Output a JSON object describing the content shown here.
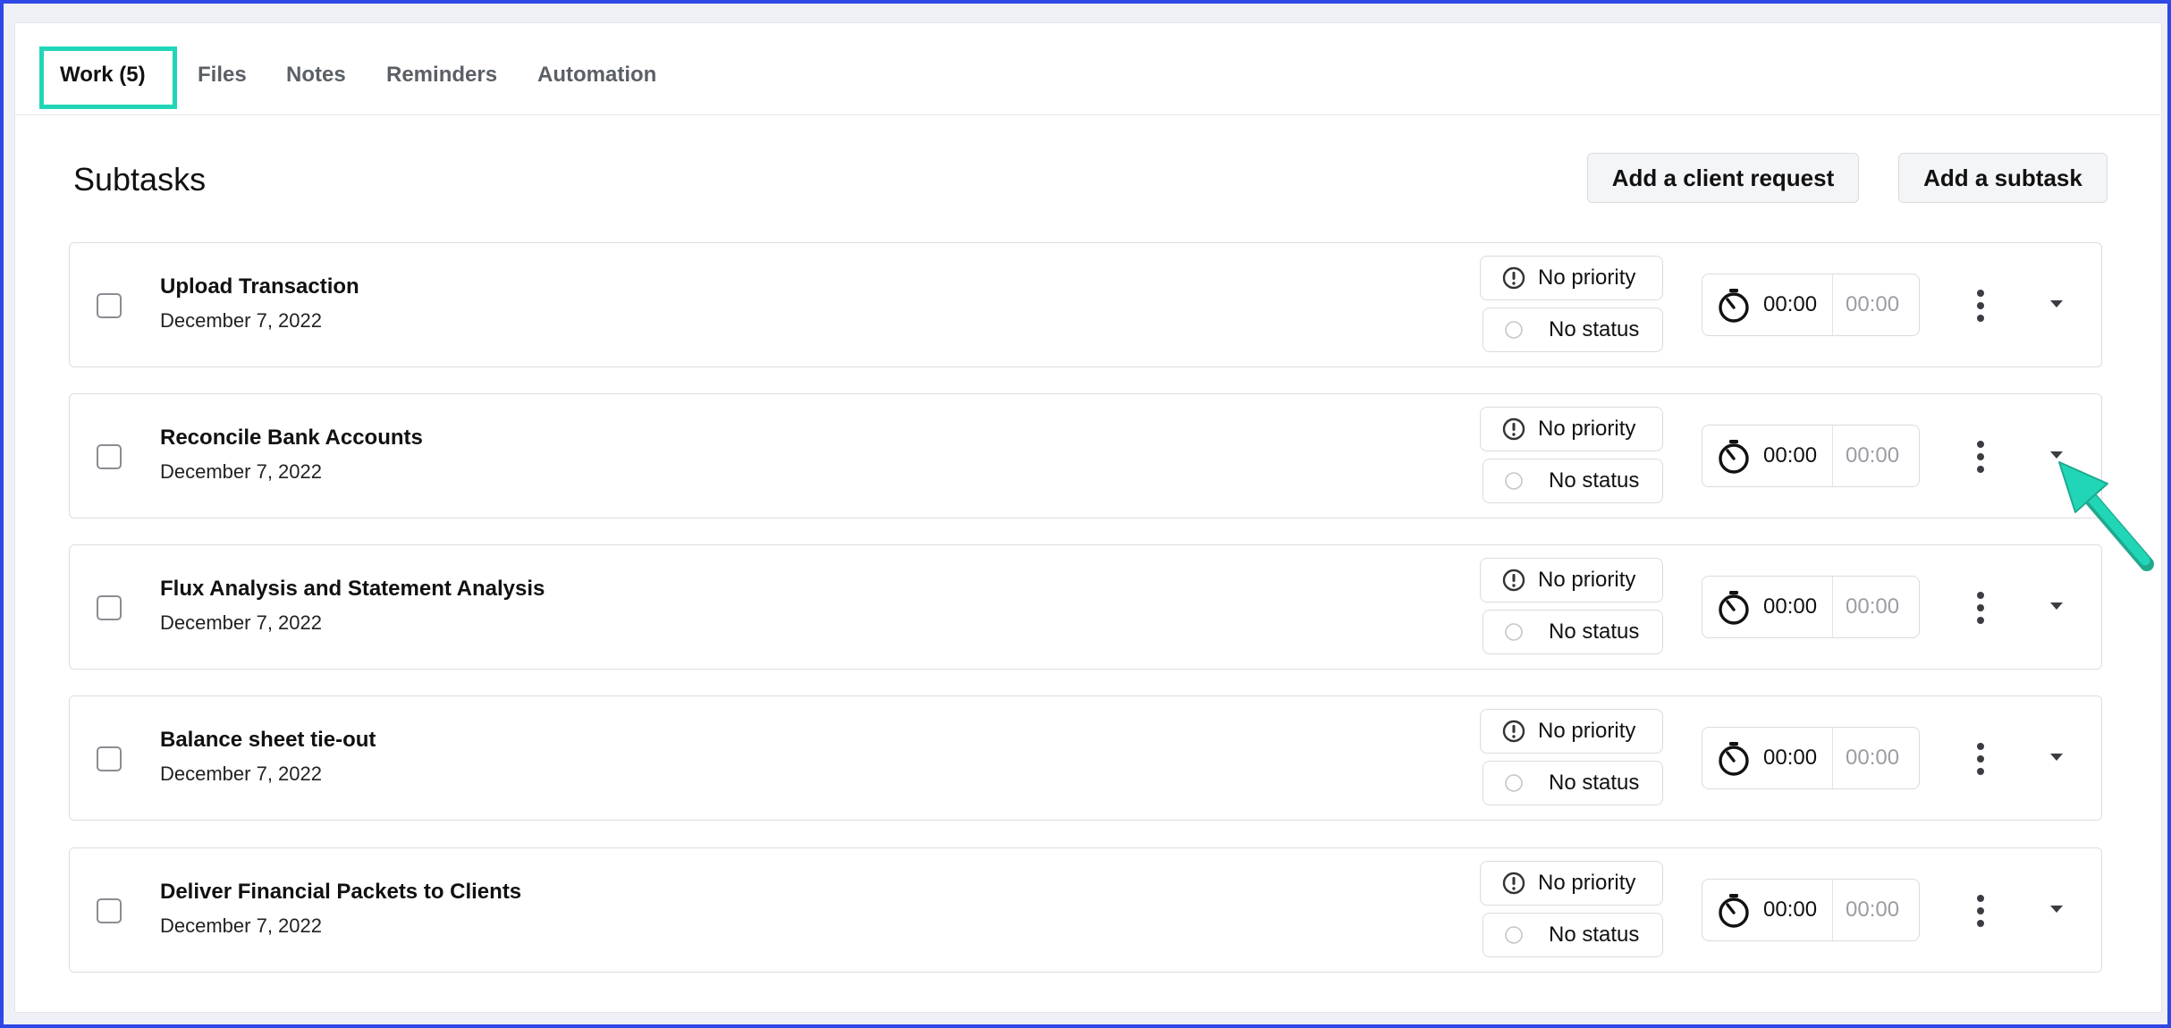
{
  "tabs": [
    {
      "label": "Work  (5)",
      "active": true
    },
    {
      "label": "Files",
      "active": false
    },
    {
      "label": "Notes",
      "active": false
    },
    {
      "label": "Reminders",
      "active": false
    },
    {
      "label": "Automation",
      "active": false
    }
  ],
  "header": {
    "title": "Subtasks",
    "add_client_request_label": "Add a client request",
    "add_subtask_label": "Add a subtask"
  },
  "subtasks": [
    {
      "name": "Upload Transaction",
      "date": "December 7, 2022",
      "priority": "No priority",
      "status": "No status",
      "time_tracked": "00:00",
      "time_estimate": "00:00"
    },
    {
      "name": "Reconcile Bank Accounts",
      "date": "December 7, 2022",
      "priority": "No priority",
      "status": "No status",
      "time_tracked": "00:00",
      "time_estimate": "00:00"
    },
    {
      "name": "Flux Analysis and Statement Analysis",
      "date": "December 7, 2022",
      "priority": "No priority",
      "status": "No status",
      "time_tracked": "00:00",
      "time_estimate": "00:00"
    },
    {
      "name": "Balance sheet tie-out",
      "date": "December 7, 2022",
      "priority": "No priority",
      "status": "No status",
      "time_tracked": "00:00",
      "time_estimate": "00:00"
    },
    {
      "name": "Deliver Financial Packets to Clients",
      "date": "December 7, 2022",
      "priority": "No priority",
      "status": "No status",
      "time_tracked": "00:00",
      "time_estimate": "00:00"
    }
  ],
  "colors": {
    "highlight": "#20d6b7",
    "frame_border": "#2f47e6",
    "annotation_arrow": "#20d6b7"
  },
  "icons": {
    "priority": "exclamation-circle-icon",
    "status": "empty-circle-icon",
    "timer": "stopwatch-icon",
    "menu": "kebab-menu-icon",
    "expand": "caret-down-icon"
  }
}
